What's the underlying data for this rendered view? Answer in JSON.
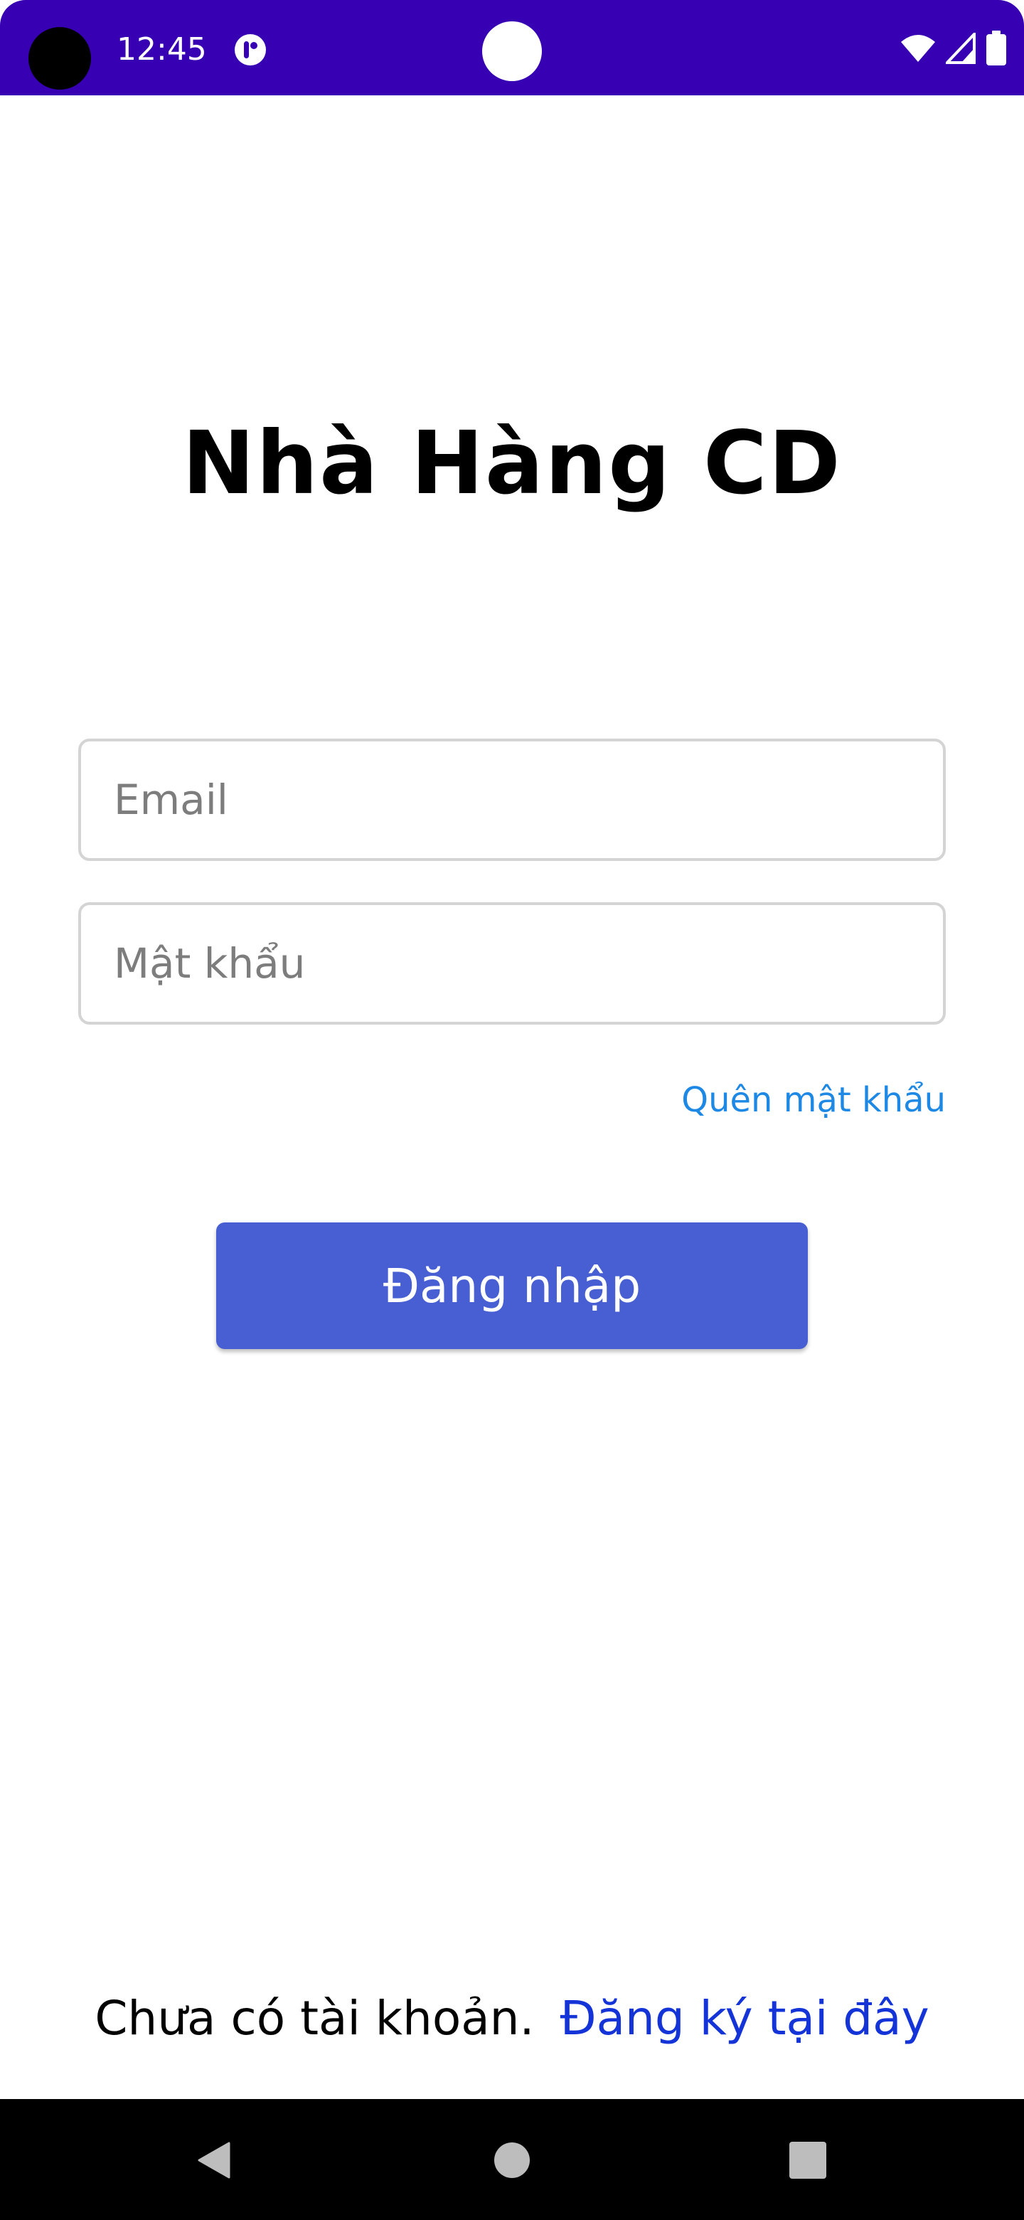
{
  "status_bar": {
    "time": "12:45",
    "background_color": "#3700b3",
    "icons": [
      "app-notification-icon",
      "wifi-icon",
      "cellular-signal-icon",
      "battery-icon"
    ]
  },
  "app": {
    "title": "Nhà Hàng CD"
  },
  "login_form": {
    "email_placeholder": "Email",
    "email_value": "",
    "password_placeholder": "Mật khẩu",
    "password_value": "",
    "forgot_password_label": "Quên mật khẩu",
    "login_button_label": "Đăng nhập",
    "login_button_color": "#485fd4",
    "link_color": "#1e88e5"
  },
  "register": {
    "prompt": "Chưa có tài khoản.",
    "link_label": "Đăng ký tại đây",
    "link_color": "#1434d8"
  },
  "navigation_bar": {
    "buttons": [
      "back-icon",
      "home-icon",
      "recents-icon"
    ]
  }
}
